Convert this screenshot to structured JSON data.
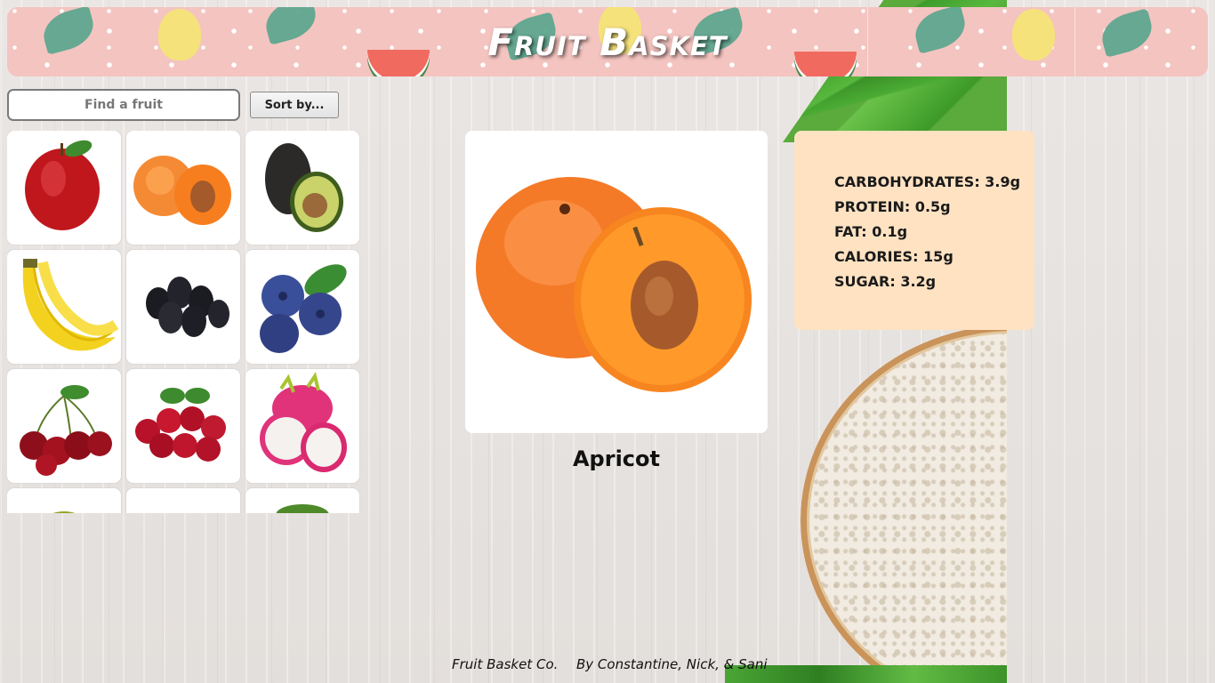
{
  "header": {
    "title": "Fruit Basket"
  },
  "search": {
    "placeholder": "Find a fruit",
    "value": ""
  },
  "sort": {
    "label": "Sort by..."
  },
  "fruits": [
    {
      "name": "apple-tile",
      "icon": "apple-image"
    },
    {
      "name": "apricot-tile",
      "icon": "apricot-image"
    },
    {
      "name": "avocado-tile",
      "icon": "avocado-image"
    },
    {
      "name": "banana-tile",
      "icon": "banana-image"
    },
    {
      "name": "blackberry-tile",
      "icon": "blackberry-image"
    },
    {
      "name": "blueberry-tile",
      "icon": "blueberry-image"
    },
    {
      "name": "cherry-tile",
      "icon": "cherry-image"
    },
    {
      "name": "cranberry-tile",
      "icon": "cranberry-image"
    },
    {
      "name": "dragonfruit-tile",
      "icon": "dragonfruit-image"
    },
    {
      "name": "durian-tile",
      "icon": "durian-image"
    },
    {
      "name": "fruit-tile",
      "icon": "fruit-image"
    },
    {
      "name": "fruit-tile",
      "icon": "fruit-image"
    }
  ],
  "selected": {
    "name": "Apricot",
    "nutrition": [
      "CARBOHYDRATES: 3.9g",
      "PROTEIN: 0.5g",
      "FAT: 0.1g",
      "CALORIES: 15g",
      "SUGAR: 3.2g"
    ]
  },
  "footer": {
    "company": "Fruit Basket Co.",
    "credits": "By Constantine, Nick, & Sani"
  },
  "colors": {
    "header_bg": "#f4c4c0",
    "nutrition_bg": "#ffe2c2",
    "tile_bg": "#ffffff"
  }
}
